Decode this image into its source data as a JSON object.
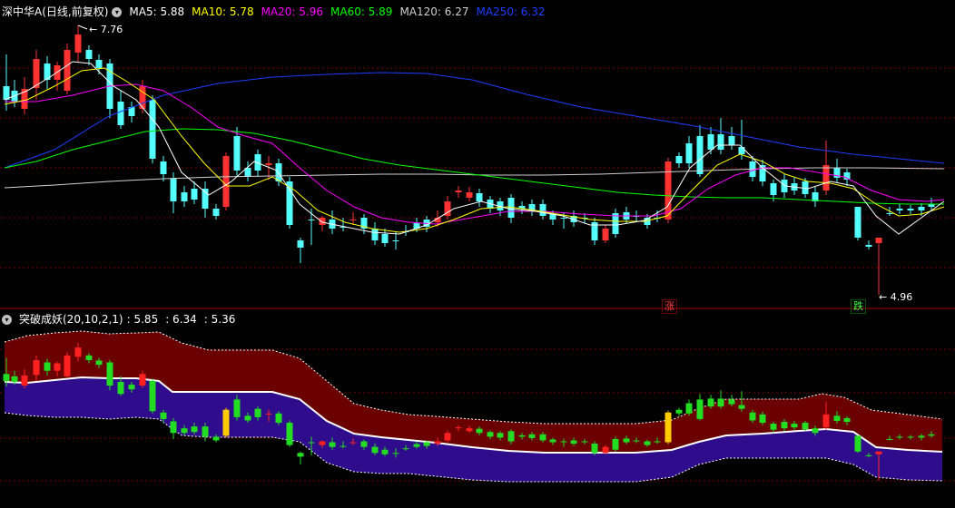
{
  "main_panel": {
    "stock_title": "深中华A(日线,前复权)",
    "ma_items": [
      {
        "label": "MA5: 5.88",
        "color": "#ffffff"
      },
      {
        "label": "MA10: 5.78",
        "color": "#ffff00"
      },
      {
        "label": "MA20: 5.96",
        "color": "#ff00ff"
      },
      {
        "label": "MA60: 5.89",
        "color": "#00ff00"
      },
      {
        "label": "MA120: 6.27",
        "color": "#d0d0d0"
      },
      {
        "label": "MA250: 6.32",
        "color": "#1e3cff"
      }
    ],
    "high_label": "7.76",
    "low_label": "4.96",
    "rise_tag": "涨",
    "fall_tag": "跌"
  },
  "sub_panel": {
    "indicator_title": "突破成妖(20,10,2,1)",
    "values": [
      ": 5.85",
      ": 6.34",
      ": 5.36"
    ]
  },
  "colors": {
    "up": "#ff3232",
    "down": "#54ffff",
    "sub_up": "#ff2020",
    "sub_down": "#22dd22",
    "breakout": "#ffcc00",
    "band_upper": "#6a0000",
    "band_lower": "#2e0c8c",
    "grid": "#7a0000"
  }
}
